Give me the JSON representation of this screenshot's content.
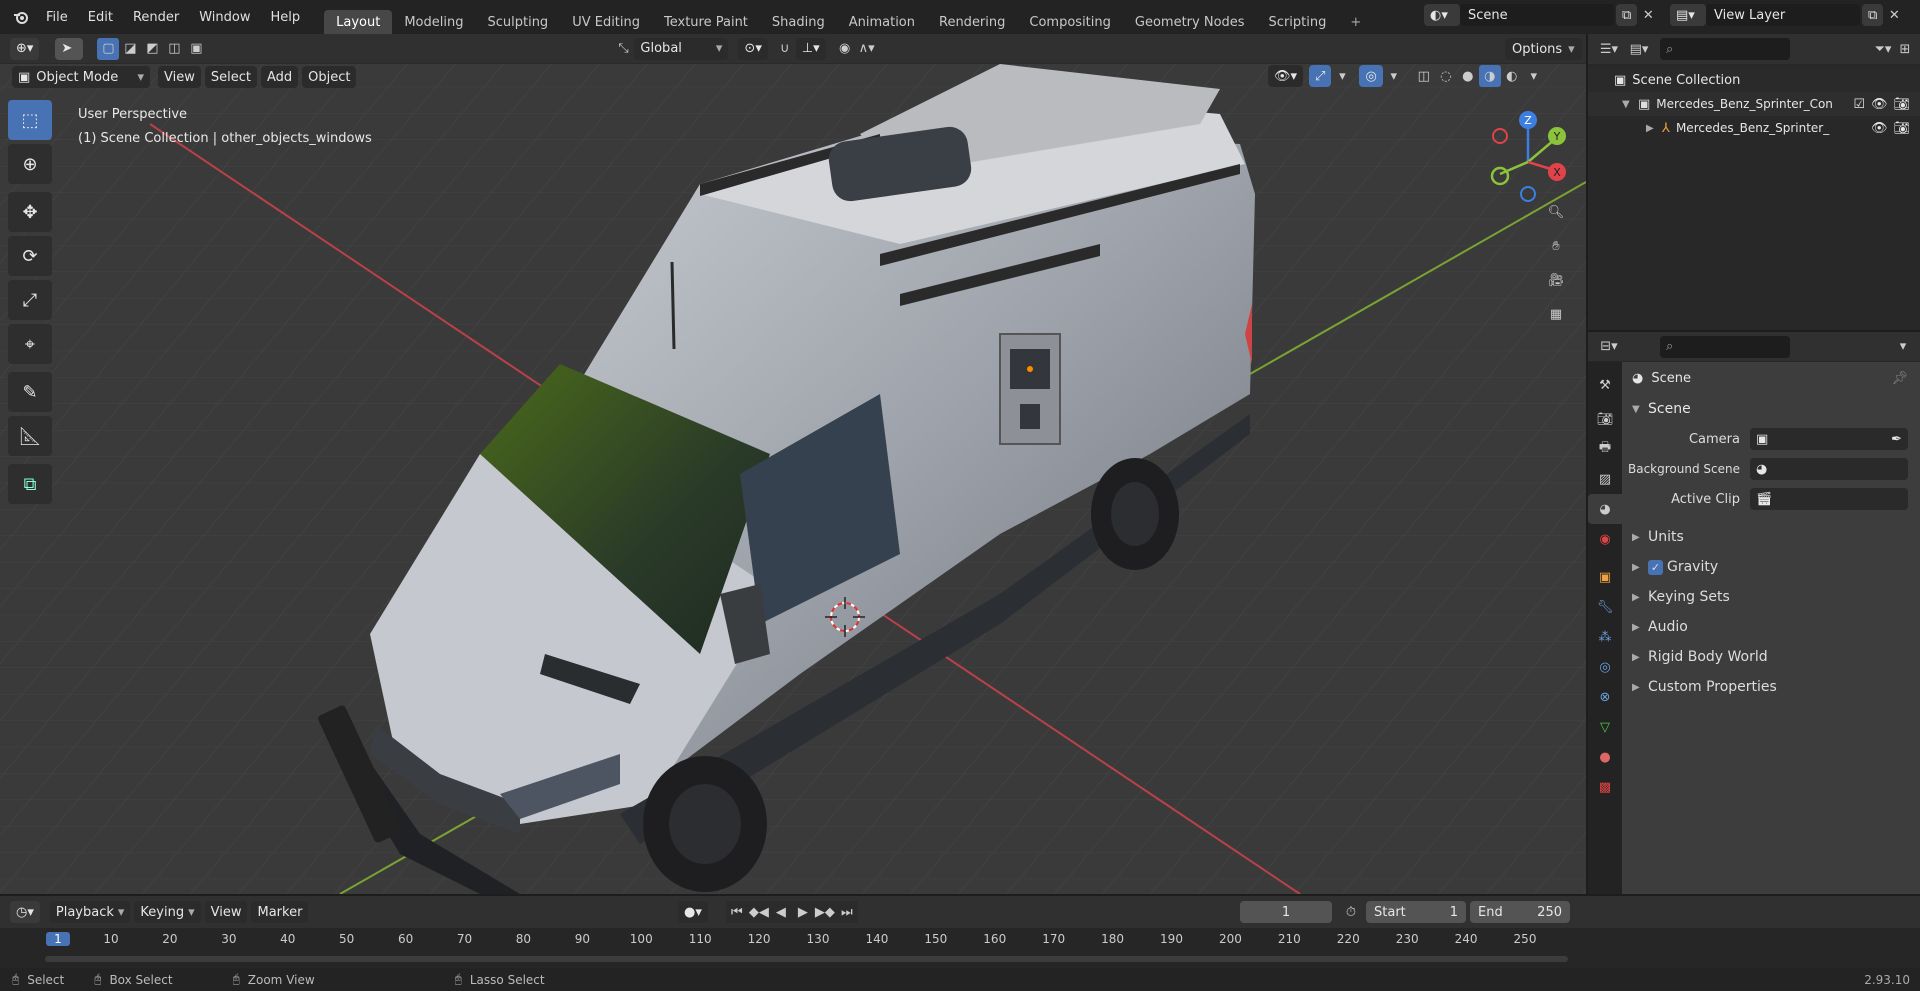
{
  "topbar": {
    "menu": [
      "File",
      "Edit",
      "Render",
      "Window",
      "Help"
    ],
    "workspaces": [
      "Layout",
      "Modeling",
      "Sculpting",
      "UV Editing",
      "Texture Paint",
      "Shading",
      "Animation",
      "Rendering",
      "Compositing",
      "Geometry Nodes",
      "Scripting"
    ],
    "active_workspace": "Layout",
    "scene": "Scene",
    "view_layer": "View Layer"
  },
  "viewport_header": {
    "mode": "Object Mode",
    "menu": [
      "View",
      "Select",
      "Add",
      "Object"
    ],
    "transform_orientation": "Global",
    "options": "Options"
  },
  "viewport": {
    "perspective": "User Perspective",
    "collection_info": "(1) Scene Collection | other_objects_windows"
  },
  "gizmo": {
    "z": "Z",
    "y": "Y",
    "x": "X"
  },
  "outliner": {
    "root": "Scene Collection",
    "items": [
      {
        "label": "Mercedes_Benz_Sprinter_Con"
      },
      {
        "label": "Mercedes_Benz_Sprinter_"
      }
    ]
  },
  "properties": {
    "context": "Scene",
    "panel": "Scene",
    "fields": [
      {
        "label": "Camera"
      },
      {
        "label": "Background Scene"
      },
      {
        "label": "Active Clip"
      }
    ],
    "sections": [
      "Units",
      "Gravity",
      "Keying Sets",
      "Audio",
      "Rigid Body World",
      "Custom Properties"
    ]
  },
  "timeline": {
    "menu": [
      "Playback",
      "Keying",
      "View",
      "Marker"
    ],
    "current_frame": "1",
    "start_label": "Start",
    "start": "1",
    "end_label": "End",
    "end": "250",
    "ruler": [
      "1",
      "10",
      "20",
      "30",
      "40",
      "50",
      "60",
      "70",
      "80",
      "90",
      "100",
      "110",
      "120",
      "130",
      "140",
      "150",
      "160",
      "170",
      "180",
      "190",
      "200",
      "210",
      "220",
      "230",
      "240",
      "250"
    ]
  },
  "statusbar": {
    "select": "Select",
    "box_select": "Box Select",
    "zoom_view": "Zoom View",
    "lasso_select": "Lasso Select",
    "version": "2.93.10"
  },
  "colors": {
    "accent": "#4772b3",
    "x_axis": "#e0434a",
    "y_axis": "#8bc33c",
    "z_axis": "#3c7fe0"
  }
}
